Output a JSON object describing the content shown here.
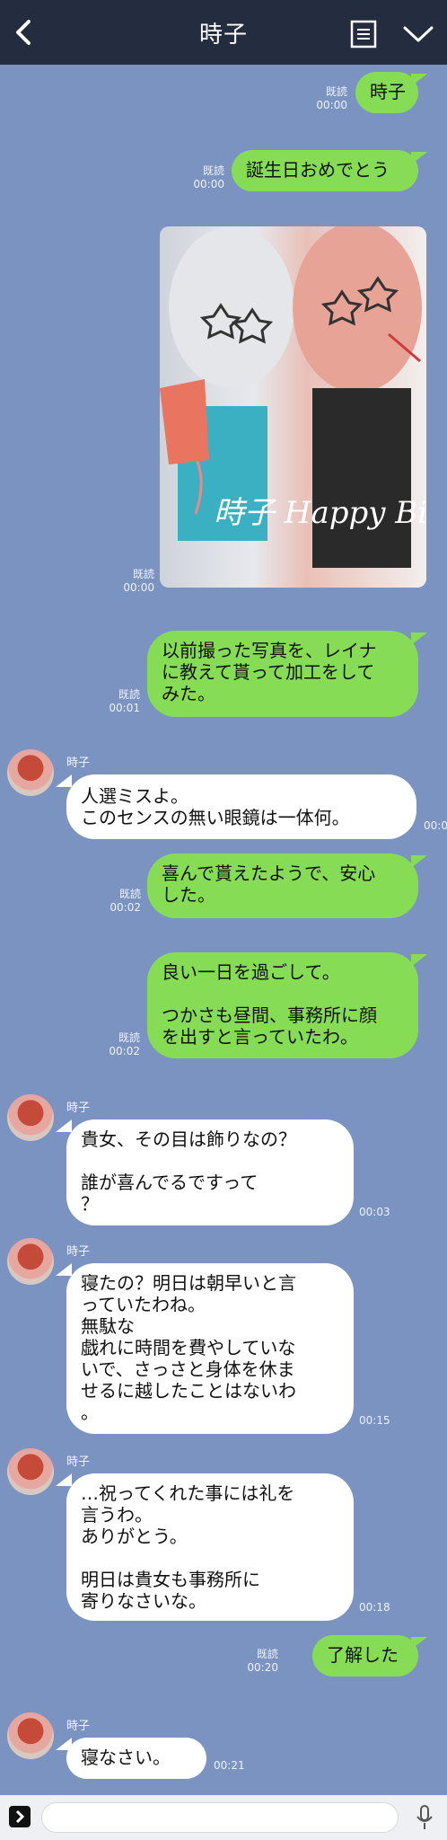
{
  "header": {
    "title": "時子"
  },
  "status": {
    "read": "既読"
  },
  "messages": [
    {
      "text": "時子",
      "time": "00:00"
    },
    {
      "text": "誕生日おめでとう",
      "time": "00:00"
    },
    {
      "image_text": "時子 Happy Birthday.",
      "time": "00:00"
    },
    {
      "text": "以前撮った写真を、レイナ\nに教えて貰って加工をして\nみた。",
      "time": "00:01"
    },
    {
      "sender": "時子",
      "text": "人選ミスよ。\nこのセンスの無い眼鏡は一体何。",
      "time": "00:0"
    },
    {
      "text": "喜んで貰えたようで、安心\nした。",
      "time": "00:02"
    },
    {
      "text": "良い一日を過ごして。\n\nつかさも昼間、事務所に顔\nを出すと言っていたわ。",
      "time": "00:02"
    },
    {
      "sender": "時子",
      "text": "貴女、その目は飾りなの？\n\n誰が喜んでるですって\n？",
      "time": "00:03"
    },
    {
      "sender": "時子",
      "text": "寝たの？明日は朝早いと言\nっていたわね。\n無駄な\n戯れに時間を費やしていな\nいで、さっさと身体を休ま\nせるに越したことはないわ\n。",
      "time": "00:15"
    },
    {
      "sender": "時子",
      "text": "…祝ってくれた事には礼を\n言うわ。\nありがとう。\n\n明日は貴女も事務所に\n寄りなさいな。",
      "time": "00:18"
    },
    {
      "text": "了解した",
      "time": "00:20"
    },
    {
      "sender": "時子",
      "text": "寝なさい。",
      "time": "00:21"
    }
  ],
  "icons": [
    "back-icon",
    "menu-icon",
    "chevron-down-icon",
    "expand-icon",
    "emoji-icon",
    "mic-icon"
  ]
}
